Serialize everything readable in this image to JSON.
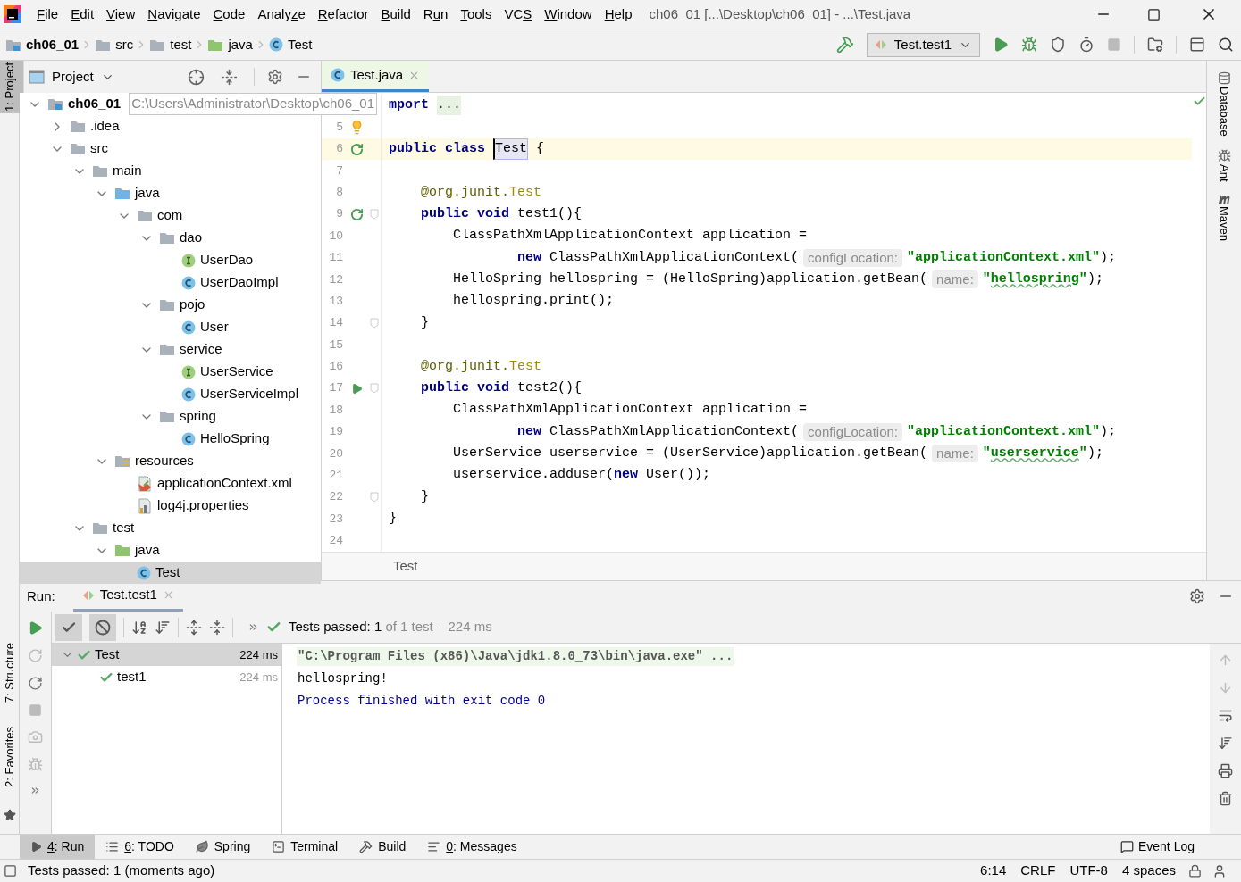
{
  "title_bar": {
    "menu": [
      {
        "key": "F",
        "rest": "ile"
      },
      {
        "key": "E",
        "rest": "dit"
      },
      {
        "key": "V",
        "rest": "iew"
      },
      {
        "key": "N",
        "rest": "avigate"
      },
      {
        "key": "C",
        "rest": "ode"
      },
      {
        "pre": "Analy",
        "key": "z",
        "rest": "e"
      },
      {
        "key": "R",
        "rest": "efactor"
      },
      {
        "key": "B",
        "rest": "uild"
      },
      {
        "pre": "R",
        "key": "u",
        "rest": "n"
      },
      {
        "key": "T",
        "rest": "ools"
      },
      {
        "pre": "VC",
        "key": "S"
      },
      {
        "key": "W",
        "rest": "indow"
      },
      {
        "key": "H",
        "rest": "elp"
      }
    ],
    "title": "ch06_01 [...\\Desktop\\ch06_01] - ...\\Test.java"
  },
  "nav_bar": {
    "crumbs": [
      {
        "label": "ch06_01",
        "kind": "module"
      },
      {
        "label": "src",
        "kind": "folder"
      },
      {
        "label": "test",
        "kind": "folder"
      },
      {
        "label": "java",
        "kind": "test-folder"
      },
      {
        "label": "Test",
        "kind": "class"
      }
    ],
    "run_config": "Test.test1"
  },
  "left_stripe": {
    "top": [
      {
        "label": "1: Project",
        "selected": true
      }
    ],
    "bottom": [
      {
        "label": "7: Structure",
        "selected": false
      },
      {
        "label": "2: Favorites",
        "selected": false
      }
    ]
  },
  "project": {
    "title": "Project",
    "tree": [
      {
        "label": "ch06_01",
        "kind": "module",
        "path": "C:\\Users\\Administrator\\Desktop\\ch06_01",
        "expanded": true,
        "selected": false,
        "children": [
          {
            "label": ".idea",
            "kind": "folder",
            "expanded": false,
            "selected": false
          },
          {
            "label": "src",
            "kind": "folder",
            "expanded": true,
            "selected": false,
            "children": [
              {
                "label": "main",
                "kind": "folder",
                "expanded": true,
                "selected": false,
                "children": [
                  {
                    "label": "java",
                    "kind": "src-folder",
                    "expanded": true,
                    "selected": false,
                    "children": [
                      {
                        "label": "com",
                        "kind": "package",
                        "expanded": true,
                        "selected": false,
                        "children": [
                          {
                            "label": "dao",
                            "kind": "package",
                            "expanded": true,
                            "selected": false,
                            "children": [
                              {
                                "label": "UserDao",
                                "kind": "interface",
                                "selected": false
                              },
                              {
                                "label": "UserDaoImpl",
                                "kind": "class",
                                "selected": false
                              }
                            ]
                          },
                          {
                            "label": "pojo",
                            "kind": "package",
                            "expanded": true,
                            "selected": false,
                            "children": [
                              {
                                "label": "User",
                                "kind": "class",
                                "selected": false
                              }
                            ]
                          },
                          {
                            "label": "service",
                            "kind": "package",
                            "expanded": true,
                            "selected": false,
                            "children": [
                              {
                                "label": "UserService",
                                "kind": "interface",
                                "selected": false
                              },
                              {
                                "label": "UserServiceImpl",
                                "kind": "class",
                                "selected": false
                              }
                            ]
                          },
                          {
                            "label": "spring",
                            "kind": "package",
                            "expanded": true,
                            "selected": false,
                            "children": [
                              {
                                "label": "HelloSpring",
                                "kind": "class",
                                "selected": false
                              }
                            ]
                          }
                        ]
                      }
                    ]
                  },
                  {
                    "label": "resources",
                    "kind": "res-folder",
                    "expanded": true,
                    "selected": false,
                    "children": [
                      {
                        "label": "applicationContext.xml",
                        "kind": "xml",
                        "selected": false
                      },
                      {
                        "label": "log4j.properties",
                        "kind": "properties",
                        "selected": false
                      }
                    ]
                  }
                ]
              },
              {
                "label": "test",
                "kind": "folder",
                "expanded": true,
                "selected": false,
                "children": [
                  {
                    "label": "java",
                    "kind": "test-folder",
                    "expanded": true,
                    "selected": false,
                    "children": [
                      {
                        "label": "Test",
                        "kind": "class",
                        "selected": true
                      }
                    ]
                  }
                ]
              }
            ]
          }
        ]
      }
    ]
  },
  "editor": {
    "tabs": [
      {
        "label": "Test.java",
        "selected": true
      }
    ],
    "lines": [
      {
        "tokens": [
          {
            "kind": "kw",
            "text": "mport "
          },
          {
            "kind": "fold",
            "text": "..."
          }
        ]
      },
      {
        "number": "5",
        "kind": "bulb"
      },
      {
        "number": "6",
        "kind": "run-all",
        "current": true,
        "tokens": [
          {
            "kind": "kw",
            "text": "public class "
          },
          {
            "kind": "ident-hl",
            "text": "Test"
          },
          {
            "kind": "plain",
            "text": " {"
          }
        ]
      },
      {
        "number": "7"
      },
      {
        "number": "8",
        "tokens": [
          {
            "kind": "ann",
            "text": "    @org.junit."
          },
          {
            "kind": "ann2",
            "text": "Test"
          }
        ]
      },
      {
        "number": "9",
        "kind": "run-all",
        "fold": true,
        "tokens": [
          {
            "kind": "kw",
            "text": "    public void "
          },
          {
            "kind": "plain",
            "text": "test1(){"
          }
        ]
      },
      {
        "number": "10",
        "tokens": [
          {
            "kind": "plain",
            "text": "        ClassPathXmlApplicationContext application ="
          }
        ]
      },
      {
        "number": "11",
        "tokens": [
          {
            "kind": "kw",
            "text": "                new "
          },
          {
            "kind": "plain",
            "text": "ClassPathXmlApplicationContext("
          },
          {
            "kind": "hint",
            "text": "configLocation:"
          },
          {
            "kind": "str",
            "text": "\"applicationContext.xml\""
          },
          {
            "kind": "plain",
            "text": ");"
          }
        ]
      },
      {
        "number": "12",
        "tokens": [
          {
            "kind": "plain",
            "text": "        HelloSpring hellospring = (HelloSpring)application.getBean("
          },
          {
            "kind": "hint",
            "text": "name:"
          },
          {
            "kind": "str",
            "text": "\""
          },
          {
            "kind": "str-typo",
            "text": "hellospring"
          },
          {
            "kind": "str",
            "text": "\""
          },
          {
            "kind": "plain",
            "text": ");"
          }
        ]
      },
      {
        "number": "13",
        "tokens": [
          {
            "kind": "plain",
            "text": "        hellospring.print();"
          }
        ]
      },
      {
        "number": "14",
        "fold": true,
        "tokens": [
          {
            "kind": "plain",
            "text": "    }"
          }
        ]
      },
      {
        "number": "15"
      },
      {
        "number": "16",
        "tokens": [
          {
            "kind": "ann",
            "text": "    @org.junit."
          },
          {
            "kind": "ann2",
            "text": "Test"
          }
        ]
      },
      {
        "number": "17",
        "kind": "run",
        "fold": true,
        "tokens": [
          {
            "kind": "kw",
            "text": "    public void "
          },
          {
            "kind": "plain",
            "text": "test2(){"
          }
        ]
      },
      {
        "number": "18",
        "tokens": [
          {
            "kind": "plain",
            "text": "        ClassPathXmlApplicationContext application ="
          }
        ]
      },
      {
        "number": "19",
        "tokens": [
          {
            "kind": "kw",
            "text": "                new "
          },
          {
            "kind": "plain",
            "text": "ClassPathXmlApplicationContext("
          },
          {
            "kind": "hint",
            "text": "configLocation:"
          },
          {
            "kind": "str",
            "text": "\"applicationContext.xml\""
          },
          {
            "kind": "plain",
            "text": ");"
          }
        ]
      },
      {
        "number": "20",
        "tokens": [
          {
            "kind": "plain",
            "text": "        UserService userservice = (UserService)application.getBean("
          },
          {
            "kind": "hint",
            "text": "name:"
          },
          {
            "kind": "str",
            "text": "\""
          },
          {
            "kind": "str-typo",
            "text": "userservice"
          },
          {
            "kind": "str",
            "text": "\""
          },
          {
            "kind": "plain",
            "text": ");"
          }
        ]
      },
      {
        "number": "21",
        "tokens": [
          {
            "kind": "plain",
            "text": "        userservice.adduser("
          },
          {
            "kind": "kw2",
            "text": "new"
          },
          {
            "kind": "plain",
            "text": " User());"
          }
        ]
      },
      {
        "number": "22",
        "fold": true,
        "tokens": [
          {
            "kind": "plain",
            "text": "    }"
          }
        ]
      },
      {
        "number": "23",
        "tokens": [
          {
            "kind": "plain",
            "text": "}"
          }
        ]
      },
      {
        "number": "24"
      }
    ],
    "breadcrumb": "Test"
  },
  "right_stripe": [
    {
      "label": "Database",
      "kind": "database"
    },
    {
      "label": "Ant",
      "kind": "ant"
    },
    {
      "label": "Maven",
      "kind": "maven"
    }
  ],
  "run": {
    "label": "Run:",
    "tabs": [
      {
        "label": "Test.test1",
        "selected": true
      }
    ],
    "filters": [
      {
        "kind": "passed",
        "on": true
      },
      {
        "kind": "ignored",
        "on": true
      }
    ],
    "summary": {
      "bold": "Tests passed: ",
      "count": "1",
      "rest": " of 1 test – 224 ms"
    },
    "tests": [
      {
        "name": "Test",
        "time": "224 ms",
        "selected": true,
        "children": [
          {
            "name": "test1",
            "time": "224 ms",
            "selected": false
          }
        ]
      }
    ],
    "console": [
      {
        "kind": "command",
        "text": "\"C:\\Program Files (x86)\\Java\\jdk1.8.0_73\\bin\\java.exe\" ..."
      },
      {
        "kind": "output",
        "text": "hellospring!"
      },
      {
        "kind": "system",
        "text": "Process finished with exit code 0"
      }
    ]
  },
  "tool_windows": [
    {
      "key": "4",
      "label": ": Run",
      "kind": "run",
      "selected": true
    },
    {
      "key": "6",
      "label": ": TODO",
      "kind": "todo",
      "selected": false
    },
    {
      "label": "Spring",
      "kind": "spring",
      "selected": false
    },
    {
      "label": "Terminal",
      "kind": "terminal",
      "selected": false
    },
    {
      "label": "Build",
      "kind": "build",
      "selected": false
    },
    {
      "key": "0",
      "label": ": Messages",
      "kind": "messages",
      "selected": false
    }
  ],
  "event_log": "Event Log",
  "status_bar": {
    "message": "Tests passed: 1 (moments ago)",
    "items": [
      "6:14",
      "CRLF",
      "UTF-8",
      "4 spaces"
    ]
  }
}
